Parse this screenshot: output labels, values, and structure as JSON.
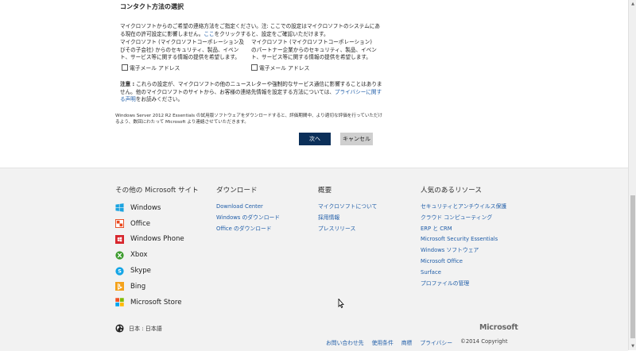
{
  "contact": {
    "title": "コンタクト方法の選択",
    "intro_text": "マイクロソフトからのご希望の連絡方法をご指定ください。注: ここでの設定はマイクロソフトのシステムにある現在の許可設定に影響しません。",
    "intro_link": "ここ",
    "intro_after": "をクリックすると、設定をご確認いただけます。",
    "col1_text": "マイクロソフト (マイクロソフトコーポレーション及びその子会社) からのセキュリティ、製品、イベント、サービス等に関する情報の提供を希望します。",
    "col2_text": "マイクロソフト (マイクロソフトコーポレーション) のパートナー企業からのセキュリティ、製品、イベント、サービス等に関する情報の提供を希望します。",
    "checkbox1_label": "電子メール アドレス",
    "checkbox2_label": "電子メール アドレス",
    "note_label": "注意 :",
    "note_text": " これらの設定が、マイクロソフトの他のニュースレターや強制的なサービス通信に影響することはありません。他のマイクロソフトのサイトから、お客様の連絡先情報を設定する方法については、",
    "note_link": "プライバシーに関する声明",
    "note_after": "をお読みください。",
    "disclaimer": "Windows Server 2012 R2 Essentials の試用版ソフトウェアをダウンロードすると、評価期間中、より適切な評価を行っていただけるよう、数回にわたって Microsoft より連絡させていただきます。",
    "next_label": "次へ",
    "cancel_label": "キャンセル"
  },
  "footer": {
    "sites_heading": "その他の Microsoft サイト",
    "sites": [
      {
        "label": "Windows",
        "icon": "windows-icon"
      },
      {
        "label": "Office",
        "icon": "office-icon"
      },
      {
        "label": "Windows Phone",
        "icon": "windows-phone-icon"
      },
      {
        "label": "Xbox",
        "icon": "xbox-icon"
      },
      {
        "label": "Skype",
        "icon": "skype-icon"
      },
      {
        "label": "Bing",
        "icon": "bing-icon"
      },
      {
        "label": "Microsoft Store",
        "icon": "microsoft-store-icon"
      }
    ],
    "download_heading": "ダウンロード",
    "download_links": [
      "Download Center",
      "Windows のダウンロード",
      "Office のダウンロード"
    ],
    "overview_heading": "概要",
    "overview_links": [
      "マイクロソフトについて",
      "採用情報",
      "プレスリリース"
    ],
    "popular_heading": "人気のあるリソース",
    "popular_links": [
      "セキュリティとアンチウイルス保護",
      "クラウド コンピューティング",
      "ERP と CRM",
      "Microsoft Security Essentials",
      "Windows ソフトウェア",
      "Microsoft Office",
      "Surface",
      "プロファイルの管理"
    ],
    "locale": "日本 : 日本語",
    "brand": "Microsoft",
    "legal_links": [
      "お問い合わせ先",
      "使用条件",
      "商標",
      "プライバシー"
    ],
    "copyright": "©2014 Copyright"
  },
  "colors": {
    "link": "#1f5da8",
    "next_button": "#0b2f59",
    "cancel_button": "#cfcfcf",
    "footer_bg": "#f2f2f2"
  }
}
